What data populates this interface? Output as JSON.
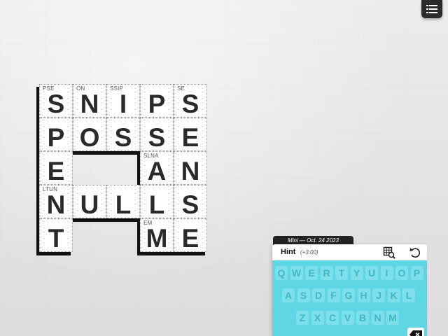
{
  "menu_icon": "list-icon",
  "puzzle": {
    "tab_label": "Mini — Oct. 24 2023",
    "rows": [
      [
        {
          "clue": "PSE",
          "letter": "S"
        },
        {
          "clue": "ON",
          "letter": "N"
        },
        {
          "clue": "SSIP",
          "letter": "I"
        },
        {
          "clue": "",
          "letter": "P"
        },
        {
          "clue": "SE",
          "letter": "S"
        }
      ],
      [
        {
          "clue": "",
          "letter": "P"
        },
        {
          "clue": "",
          "letter": "O"
        },
        {
          "clue": "",
          "letter": "S"
        },
        {
          "clue": "",
          "letter": "S"
        },
        {
          "clue": "",
          "letter": "E"
        }
      ],
      [
        {
          "clue": "",
          "letter": "E"
        },
        null,
        null,
        {
          "clue": "SLNA",
          "letter": "A"
        },
        {
          "clue": "",
          "letter": "N"
        }
      ],
      [
        {
          "clue": "LTUN",
          "letter": "N"
        },
        {
          "clue": "",
          "letter": "U"
        },
        {
          "clue": "",
          "letter": "L"
        },
        {
          "clue": "",
          "letter": "L"
        },
        {
          "clue": "",
          "letter": "S"
        }
      ],
      [
        {
          "clue": "",
          "letter": "T"
        },
        null,
        null,
        {
          "clue": "EM",
          "letter": "M"
        },
        {
          "clue": "",
          "letter": "E"
        }
      ]
    ]
  },
  "toolbar": {
    "hint_label": "Hint",
    "hint_cost": "(+3:00)",
    "reveal_icon": "magnify-grid-icon",
    "undo_icon": "undo-icon"
  },
  "keyboard": {
    "row1": [
      "Q",
      "W",
      "E",
      "R",
      "T",
      "Y",
      "U",
      "I",
      "O",
      "P"
    ],
    "row2": [
      "A",
      "S",
      "D",
      "F",
      "G",
      "H",
      "J",
      "K",
      "L"
    ],
    "row3": [
      "Z",
      "X",
      "C",
      "V",
      "B",
      "N",
      "M"
    ],
    "backspace_icon": "backspace-icon"
  },
  "colors": {
    "keyboard_bg": "#5fd6e3",
    "key_bg": "#7ddfe9",
    "key_text": "#3fb9c6",
    "ink": "#2a2a2a"
  }
}
